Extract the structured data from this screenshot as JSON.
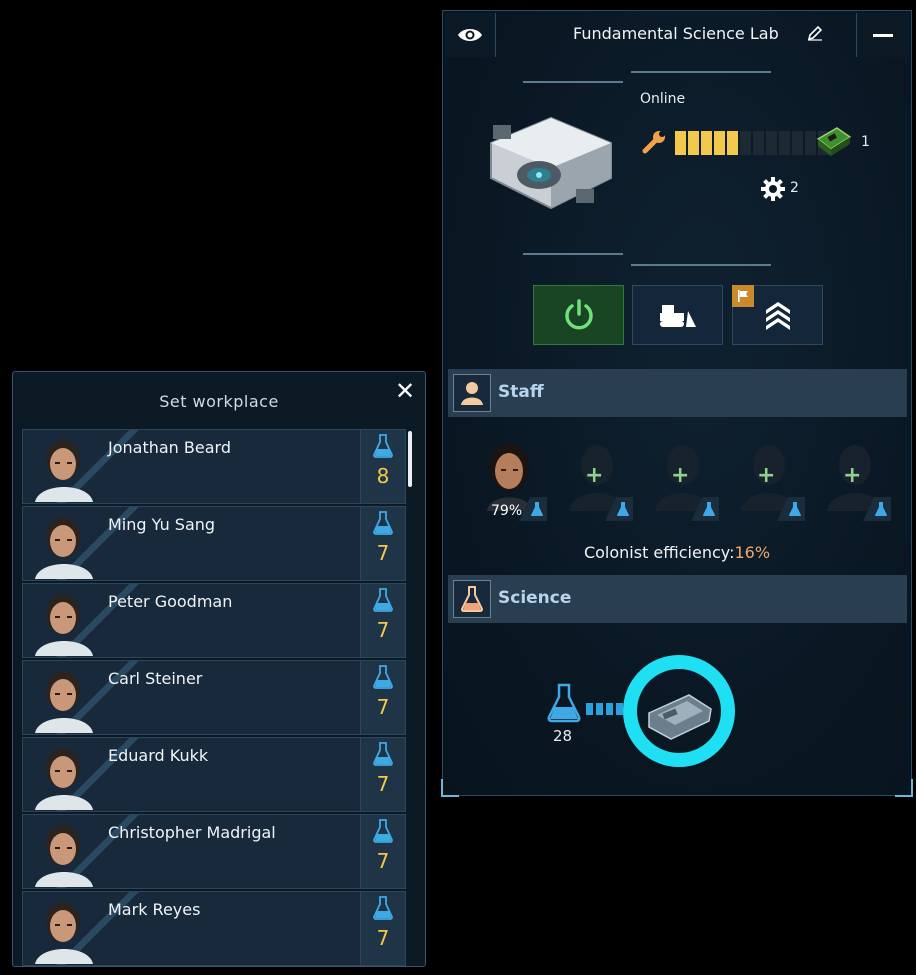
{
  "building": {
    "title": "Fundamental Science Lab",
    "status": "Online",
    "condition_segments_total": 12,
    "condition_segments_filled": 5,
    "electronics_count": "1",
    "maintenance_count": "2",
    "staff_section_label": "Staff",
    "science_section_label": "Science",
    "staff_slots": [
      {
        "filled": true,
        "efficiency": "79%"
      },
      {
        "filled": false
      },
      {
        "filled": false
      },
      {
        "filled": false
      },
      {
        "filled": false
      }
    ],
    "efficiency_label": "Colonist efficiency:",
    "efficiency_value": "16%",
    "science_output": "28",
    "colors": {
      "accent": "#29d7ee",
      "power_on": "#1a4524",
      "condition": "#f2c94c"
    }
  },
  "workplace": {
    "title": "Set workplace",
    "close_icon": "close-icon",
    "colonists": [
      {
        "name": "Jonathan Beard",
        "science": "8"
      },
      {
        "name": "Ming Yu Sang",
        "science": "7"
      },
      {
        "name": "Peter Goodman",
        "science": "7"
      },
      {
        "name": "Carl Steiner",
        "science": "7"
      },
      {
        "name": "Eduard Kukk",
        "science": "7"
      },
      {
        "name": "Christopher Madrigal",
        "science": "7"
      },
      {
        "name": "Mark Reyes",
        "science": "7"
      }
    ]
  }
}
